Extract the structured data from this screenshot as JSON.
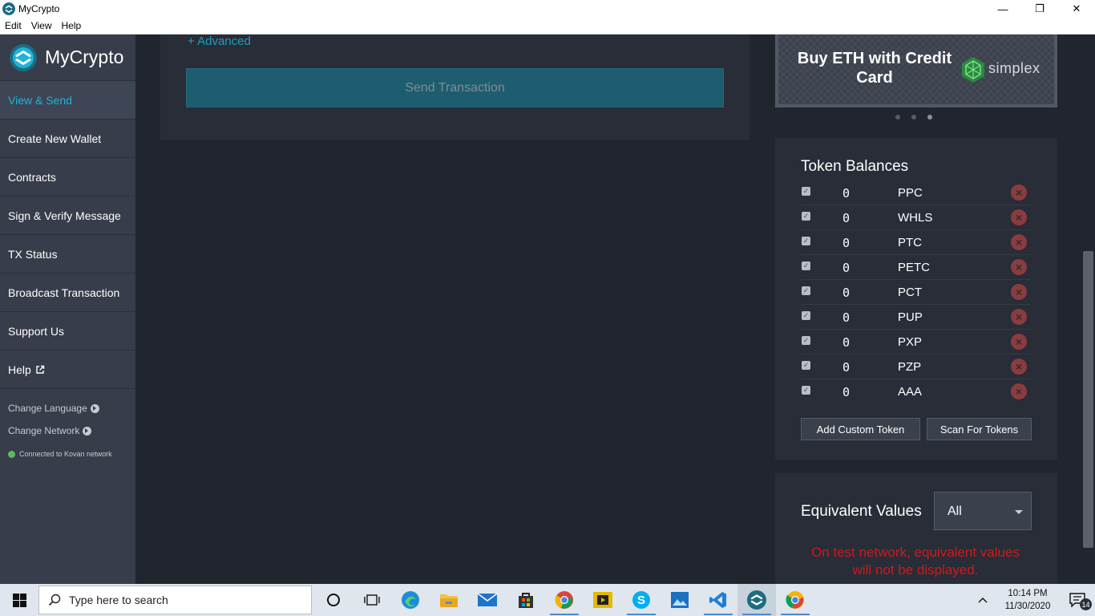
{
  "window": {
    "title": "MyCrypto",
    "minimize": "—",
    "maximize": "❐",
    "close": "✕"
  },
  "menubar": [
    "Edit",
    "View",
    "Help"
  ],
  "sidebar": {
    "brand": "MyCrypto",
    "items": [
      {
        "label": "View & Send",
        "active": true
      },
      {
        "label": "Create New Wallet"
      },
      {
        "label": "Contracts"
      },
      {
        "label": "Sign & Verify Message"
      },
      {
        "label": "TX Status"
      },
      {
        "label": "Broadcast Transaction"
      },
      {
        "label": "Support Us"
      },
      {
        "label": "Help"
      }
    ],
    "change_language": "Change Language",
    "change_network": "Change Network",
    "connection_status": "Connected to Kovan network"
  },
  "main": {
    "advanced_link": "+ Advanced",
    "send_button": "Send Transaction"
  },
  "banner": {
    "text": "Buy ETH with Credit Card",
    "partner": "simplex"
  },
  "tokens": {
    "title": "Token Balances",
    "rows": [
      {
        "balance": "0",
        "symbol": "PPC"
      },
      {
        "balance": "0",
        "symbol": "WHLS"
      },
      {
        "balance": "0",
        "symbol": "PTC"
      },
      {
        "balance": "0",
        "symbol": "PETC"
      },
      {
        "balance": "0",
        "symbol": "PCT"
      },
      {
        "balance": "0",
        "symbol": "PUP"
      },
      {
        "balance": "0",
        "symbol": "PXP"
      },
      {
        "balance": "0",
        "symbol": "PZP"
      },
      {
        "balance": "0",
        "symbol": "AAA"
      }
    ],
    "add_button": "Add Custom Token",
    "scan_button": "Scan For Tokens"
  },
  "equivalent": {
    "title": "Equivalent Values",
    "selected": "All",
    "warning": "On test network, equivalent values will not be displayed."
  },
  "taskbar": {
    "search_placeholder": "Type here to search",
    "time": "10:14 PM",
    "date": "11/30/2020",
    "notification_count": "14"
  },
  "colors": {
    "accent": "#1eb4d8",
    "sidebar_bg": "#373d4a",
    "page_bg": "#21252e",
    "card_bg": "#282d37",
    "warning": "#d0191b"
  }
}
